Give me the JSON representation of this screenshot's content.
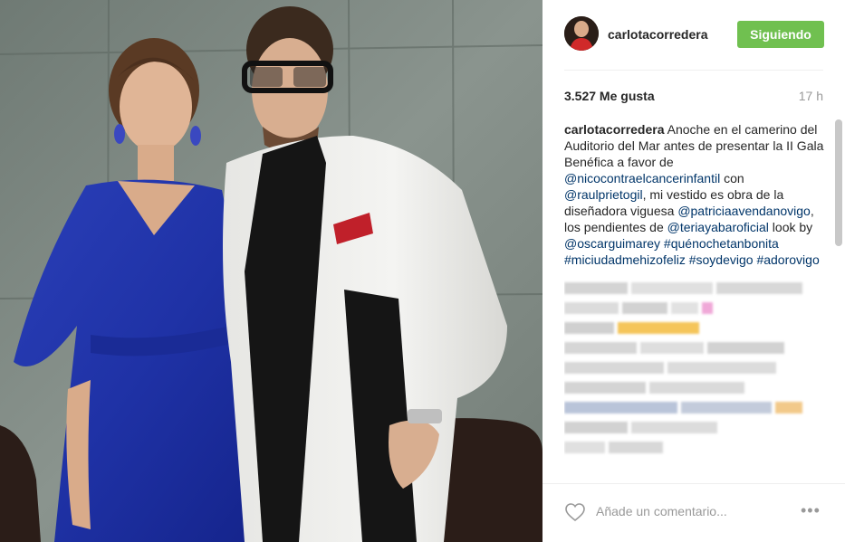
{
  "post": {
    "username": "carlotacorredera",
    "follow_label": "Siguiendo",
    "likes": "3.527 Me gusta",
    "time_ago": "17 h",
    "caption": {
      "author": "carlotacorredera",
      "text_1": " Anoche en el camerino del Auditorio del Mar antes de presentar la II Gala Benéfica a favor de ",
      "mention_1": "@nicocontraelcancerinfantil",
      "text_2": " con ",
      "mention_2": "@raulprietogil",
      "text_3": ", mi vestido es obra de la diseñadora viguesa ",
      "mention_3": "@patriciaavendanovigo",
      "text_4": ", los pendientes de ",
      "mention_4": "@teriayabaroficial",
      "text_5": " look by ",
      "mention_5": "@oscarguimarey",
      "text_6": " ",
      "hashtag_1": "#quénochetanbonita",
      "text_7": " ",
      "hashtag_2": "#miciudadmehizofeliz",
      "text_8": " ",
      "hashtag_3": "#soydevigo",
      "text_9": " ",
      "hashtag_4": "#adorovigo"
    },
    "comment_placeholder": "Añade un comentario...",
    "more_label": "•••"
  },
  "colors": {
    "follow_green": "#70c050",
    "link_blue": "#003569",
    "muted_gray": "#999999"
  },
  "icons": {
    "heart": "heart-outline-icon",
    "more": "more-options-icon"
  }
}
